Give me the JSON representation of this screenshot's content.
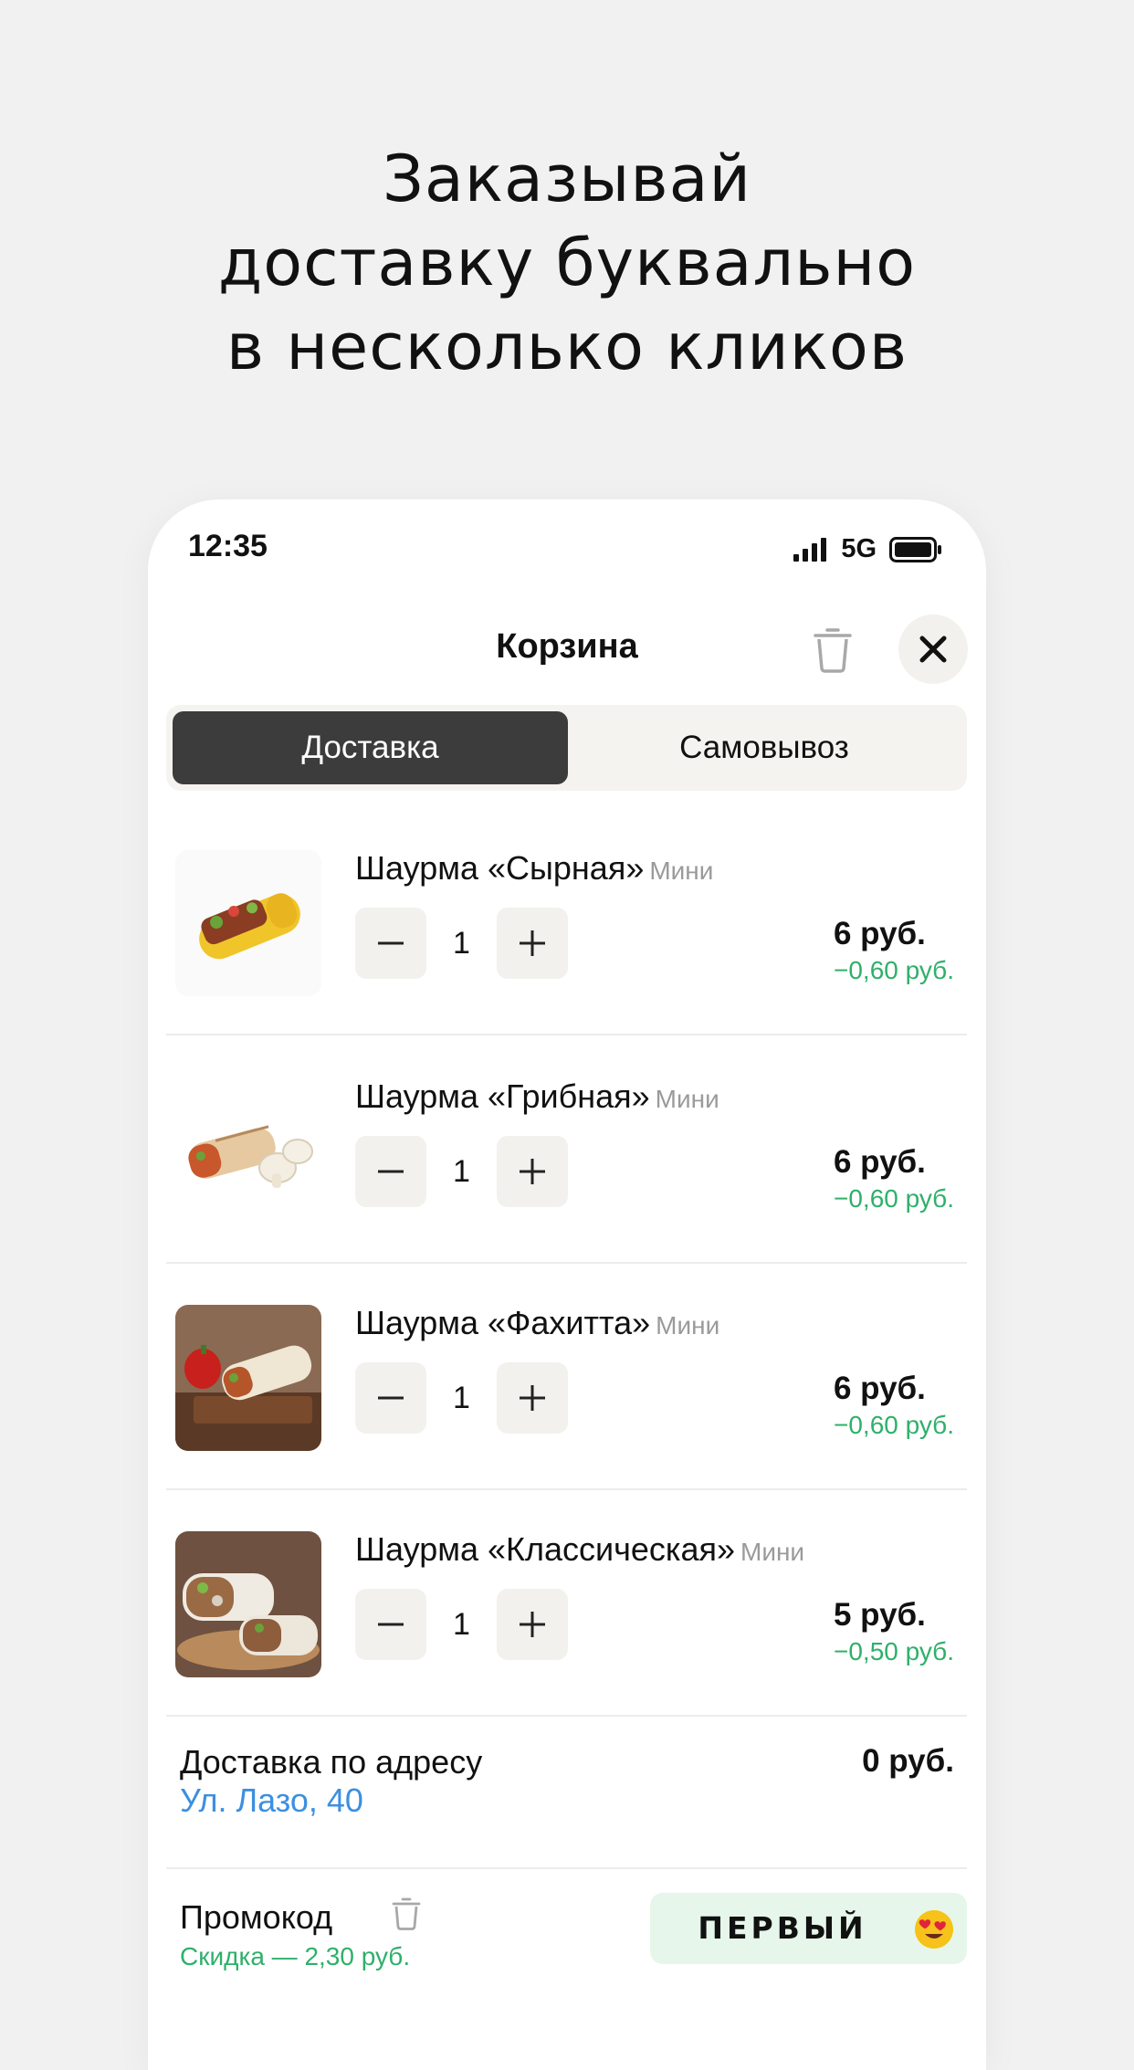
{
  "headline": {
    "line1": "Заказывай",
    "line2": "доставку буквально",
    "line3": "в несколько кликов"
  },
  "status": {
    "time": "12:35",
    "network": "5G"
  },
  "cart": {
    "title": "Корзина",
    "tabs": {
      "delivery": "Доставка",
      "pickup": "Самовывоз",
      "active": "delivery"
    },
    "items": [
      {
        "name": "Шаурма «Сырная»",
        "size": "Мини",
        "qty": "1",
        "price": "6 руб.",
        "discount": "−0,60 руб."
      },
      {
        "name": "Шаурма «Грибная»",
        "size": "Мини",
        "qty": "1",
        "price": "6 руб.",
        "discount": "−0,60 руб."
      },
      {
        "name": "Шаурма «Фахитта»",
        "size": "Мини",
        "qty": "1",
        "price": "6 руб.",
        "discount": "−0,60 руб."
      },
      {
        "name": "Шаурма «Классическая»",
        "size": "Мини",
        "qty": "1",
        "price": "5 руб.",
        "discount": "−0,50 руб."
      }
    ],
    "delivery": {
      "label": "Доставка по адресу",
      "address": "Ул. Лазо, 40",
      "cost": "0 руб."
    },
    "promo": {
      "label": "Промокод",
      "discount": "Скидка — 2,30 руб.",
      "code": "ПЕРВЫЙ",
      "emoji": "heart-eyes-emoji"
    }
  },
  "colors": {
    "accent_green": "#2fb06a",
    "link_blue": "#3d8fe0",
    "active_tab": "#3c3c3c",
    "promo_bg": "#e6f6ea"
  }
}
